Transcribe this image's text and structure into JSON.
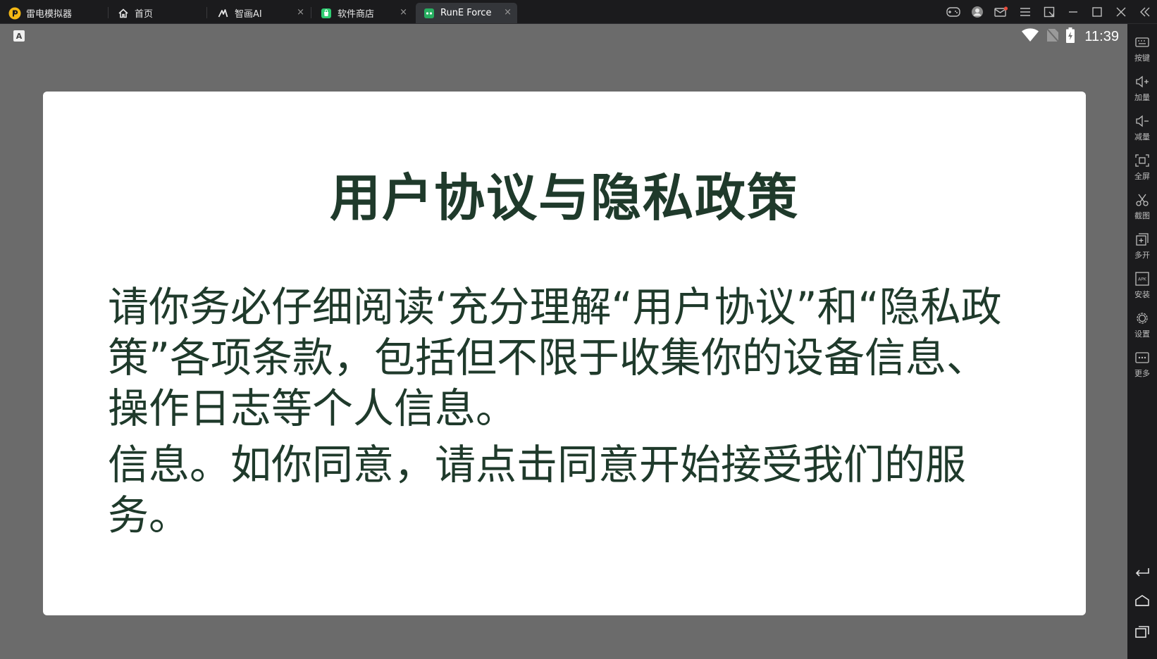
{
  "titlebar": {
    "app_name": "雷电模拟器",
    "tabs": [
      {
        "label": "首页"
      },
      {
        "label": "智画AI"
      },
      {
        "label": "软件商店"
      },
      {
        "label": "RunE Force"
      }
    ],
    "close_glyph": "×"
  },
  "statusbar": {
    "keyboard_badge": "A",
    "time": "11:39",
    "icons": [
      "wifi-icon",
      "no-sim-icon",
      "battery-charging-icon"
    ]
  },
  "dialog": {
    "title": "用户协议与隐私政策",
    "paragraph_1": "请你务必仔细阅读‘充分理解“用户协议”和“隐私政策”各项条款，包括但不限于收集你的设备信息、操作日志等个人信息。",
    "paragraph_2": "信息。如你同意，请点击同意开始接受我们的服务。"
  },
  "sidebar": {
    "items": [
      {
        "label": "按键",
        "icon": "keyboard-icon"
      },
      {
        "label": "加量",
        "icon": "volume-up-icon"
      },
      {
        "label": "减量",
        "icon": "volume-down-icon"
      },
      {
        "label": "全屏",
        "icon": "fullscreen-icon"
      },
      {
        "label": "截图",
        "icon": "scissors-icon"
      },
      {
        "label": "多开",
        "icon": "multi-instance-icon"
      },
      {
        "label": "安装",
        "icon": "apk-icon"
      },
      {
        "label": "设置",
        "icon": "gear-icon"
      },
      {
        "label": "更多",
        "icon": "more-icon"
      }
    ],
    "apk_text": "APK",
    "nav": [
      "back-icon",
      "home-icon",
      "recents-icon"
    ]
  },
  "colors": {
    "accent_green": "#1f3a2b",
    "chrome_dark": "#1b1b1d",
    "screen_dim": "#6b6b6b",
    "app_logo_yellow": "#f5b914",
    "store_green": "#2ecc71"
  }
}
